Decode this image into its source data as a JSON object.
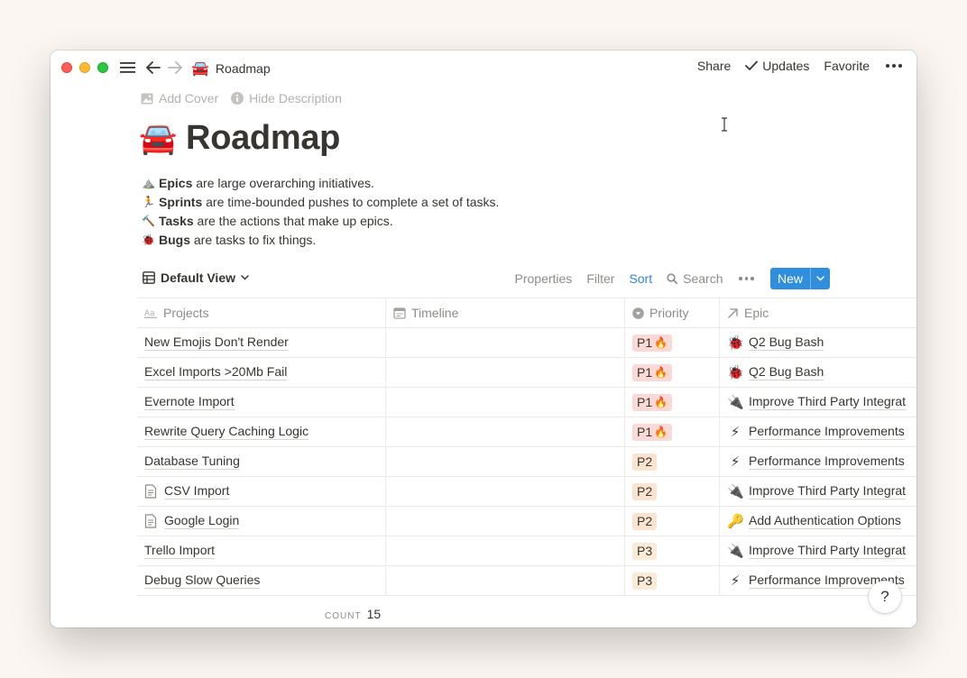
{
  "titlebar": {
    "page_emoji": "🚘",
    "page_name": "Roadmap",
    "share": "Share",
    "updates": "Updates",
    "favorite": "Favorite"
  },
  "page_actions": {
    "add_cover": "Add Cover",
    "hide_description": "Hide Description"
  },
  "page": {
    "emoji": "🚘",
    "title": "Roadmap",
    "description": [
      {
        "emoji": "⛰️",
        "term": "Epics",
        "text": " are large overarching initiatives."
      },
      {
        "emoji": "🏃",
        "term": "Sprints",
        "text": " are time-bounded pushes to complete a set of tasks."
      },
      {
        "emoji": "🔨",
        "term": "Tasks",
        "text": " are the actions that make up epics."
      },
      {
        "emoji": "🐞",
        "term": "Bugs",
        "text": " are tasks to fix things."
      }
    ]
  },
  "view": {
    "name": "Default View",
    "properties": "Properties",
    "filter": "Filter",
    "sort": "Sort",
    "search": "Search",
    "new": "New"
  },
  "table": {
    "columns": {
      "projects": "Projects",
      "timeline": "Timeline",
      "priority": "Priority",
      "epic": "Epic"
    },
    "rows": [
      {
        "name": "New Emojis Don't Render",
        "doc": false,
        "priority": "P1",
        "fire": "🔥",
        "epic_emoji": "🐞",
        "epic": "Q2 Bug Bash"
      },
      {
        "name": "Excel Imports >20Mb Fail",
        "doc": false,
        "priority": "P1",
        "fire": "🔥",
        "epic_emoji": "🐞",
        "epic": "Q2 Bug Bash"
      },
      {
        "name": "Evernote Import",
        "doc": false,
        "priority": "P1",
        "fire": "🔥",
        "epic_emoji": "🔌",
        "epic": "Improve Third Party Integrat"
      },
      {
        "name": "Rewrite Query Caching Logic",
        "doc": false,
        "priority": "P1",
        "fire": "🔥",
        "epic_emoji": "⚡",
        "epic": "Performance Improvements"
      },
      {
        "name": "Database Tuning",
        "doc": false,
        "priority": "P2",
        "fire": "",
        "epic_emoji": "⚡",
        "epic": "Performance Improvements"
      },
      {
        "name": "CSV Import",
        "doc": true,
        "priority": "P2",
        "fire": "",
        "epic_emoji": "🔌",
        "epic": "Improve Third Party Integrat"
      },
      {
        "name": "Google Login",
        "doc": true,
        "priority": "P2",
        "fire": "",
        "epic_emoji": "🔑",
        "epic": "Add Authentication Options"
      },
      {
        "name": "Trello Import",
        "doc": false,
        "priority": "P3",
        "fire": "",
        "epic_emoji": "🔌",
        "epic": "Improve Third Party Integrat"
      },
      {
        "name": "Debug Slow Queries",
        "doc": false,
        "priority": "P3",
        "fire": "",
        "epic_emoji": "⚡",
        "epic": "Performance Improvements"
      }
    ],
    "count_label": "COUNT",
    "count": "15"
  },
  "help": "?",
  "colors": {
    "accent": "#2f8fdd",
    "sort_active": "#2e86d8",
    "p1_bg": "#fbd9d6",
    "p2_bg": "#fbe3d0",
    "p3_bg": "#f9ebd6",
    "text": "#37352f",
    "muted": "#8e8c88"
  }
}
